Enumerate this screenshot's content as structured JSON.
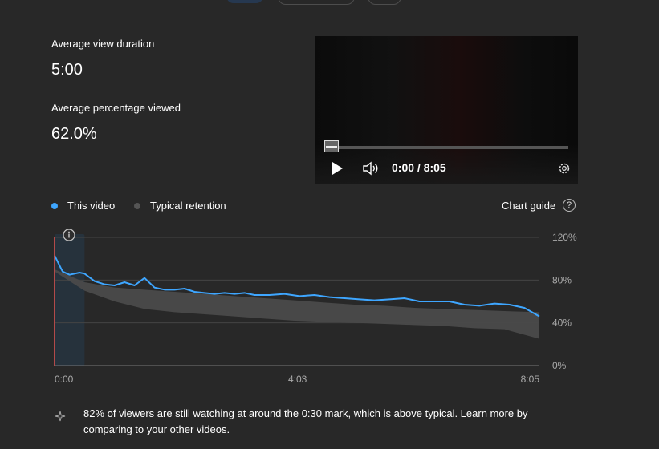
{
  "metrics": {
    "avg_view_duration_label": "Average view duration",
    "avg_view_duration_value": "5:00",
    "avg_percentage_label": "Average percentage viewed",
    "avg_percentage_value": "62.0%"
  },
  "player": {
    "time": "0:00 / 8:05",
    "icons": [
      "play-icon",
      "volume-icon",
      "settings-icon"
    ]
  },
  "legend": {
    "this_video": "This video",
    "typical": "Typical retention"
  },
  "chart_guide_label": "Chart guide",
  "colors": {
    "this_video": "#3ea6ff",
    "typical_band": "#4a4a4a",
    "typical_dot": "#555555",
    "marker": "#e05555",
    "highlight": "#26323c"
  },
  "chart_data": {
    "type": "line",
    "x_ticks": [
      "0:00",
      "4:03",
      "8:05"
    ],
    "y_ticks": [
      "0%",
      "40%",
      "80%",
      "120%"
    ],
    "ylim": [
      0,
      120
    ],
    "x_range_seconds": [
      0,
      485
    ],
    "series": [
      {
        "name": "This video",
        "x": [
          0,
          8,
          15,
          25,
          30,
          40,
          50,
          60,
          70,
          80,
          90,
          100,
          110,
          120,
          130,
          140,
          150,
          160,
          170,
          180,
          190,
          200,
          215,
          230,
          245,
          260,
          275,
          290,
          305,
          320,
          335,
          350,
          365,
          380,
          395,
          410,
          425,
          440,
          455,
          470,
          485
        ],
        "y": [
          103,
          88,
          85,
          87,
          86,
          79,
          76,
          75,
          78,
          75,
          82,
          73,
          71,
          71,
          72,
          69,
          68,
          67,
          68,
          67,
          68,
          66,
          66,
          67,
          65,
          66,
          64,
          63,
          62,
          61,
          62,
          63,
          60,
          60,
          60,
          57,
          56,
          58,
          57,
          54,
          46
        ]
      }
    ],
    "typical_band": {
      "x": [
        0,
        30,
        60,
        90,
        120,
        150,
        180,
        210,
        240,
        270,
        300,
        330,
        360,
        390,
        420,
        450,
        485
      ],
      "upper": [
        90,
        78,
        73,
        71,
        69,
        67,
        65,
        63,
        61,
        59,
        57,
        56,
        54,
        53,
        52,
        51,
        50
      ],
      "lower": [
        88,
        70,
        60,
        53,
        50,
        48,
        46,
        44,
        42,
        41,
        40,
        39,
        38,
        37,
        35,
        34,
        25
      ]
    }
  },
  "insight": "82% of viewers are still watching at around the 0:30 mark, which is above typical. Learn more by comparing to your other videos."
}
